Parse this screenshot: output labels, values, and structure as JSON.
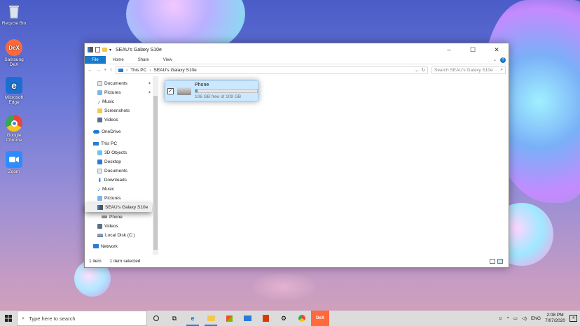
{
  "desktop": {
    "icons": [
      {
        "label": "Recycle Bin",
        "icon": "recycle-bin-icon",
        "color": "#c7d3df"
      },
      {
        "label": "Samsung DeX",
        "icon": "dex-icon",
        "color": "#ff6a3d"
      },
      {
        "label": "Microsoft Edge",
        "icon": "edge-icon",
        "color": "#1b6fd1"
      },
      {
        "label": "Google Chrome",
        "icon": "chrome-icon",
        "color": "#e8453c"
      },
      {
        "label": "Zoom",
        "icon": "zoom-icon",
        "color": "#2d8cff"
      }
    ],
    "dex_text": "DeX",
    "edge_glyph": "e"
  },
  "explorer": {
    "title": "SEAU's Galaxy S10e",
    "tabs": {
      "file": "File",
      "home": "Home",
      "share": "Share",
      "view": "View"
    },
    "breadcrumb": {
      "root": "This PC",
      "current": "SEAU's Galaxy S10e"
    },
    "search_placeholder": "Search SEAU's Galaxy S10e",
    "nav": {
      "quick": [
        "Documents",
        "Pictures",
        "Music",
        "Screenshots",
        "Videos"
      ],
      "onedrive": "OneDrive",
      "this_pc": "This PC",
      "pc_items": [
        "3D Objects",
        "Desktop",
        "Documents",
        "Downloads",
        "Music",
        "Pictures"
      ],
      "device": "SEAU's Galaxy S10e",
      "device_child": "Phone",
      "after_device": [
        "Videos",
        "Local Disk (C:)"
      ],
      "network": "Network"
    },
    "drive": {
      "name": "Phone",
      "free_text": "106 GB free of 109 GB",
      "used_fraction": 0.03
    },
    "status": {
      "count": "1 item",
      "selected": "1 item selected"
    }
  },
  "taskbar": {
    "search_placeholder": "Type here to search",
    "apps": [
      "cortana-icon",
      "task-view-icon",
      "edge-icon",
      "file-explorer-icon",
      "store-icon",
      "mail-icon",
      "office-icon",
      "settings-icon",
      "chrome-icon",
      "dex-icon"
    ],
    "language": "ENG",
    "time": "2:08 PM",
    "date": "7/07/2020",
    "notification_count": "4"
  },
  "colors": {
    "accent": "#1979ca",
    "selection": "#cce8ff",
    "drive_bar": "#26a0da"
  }
}
